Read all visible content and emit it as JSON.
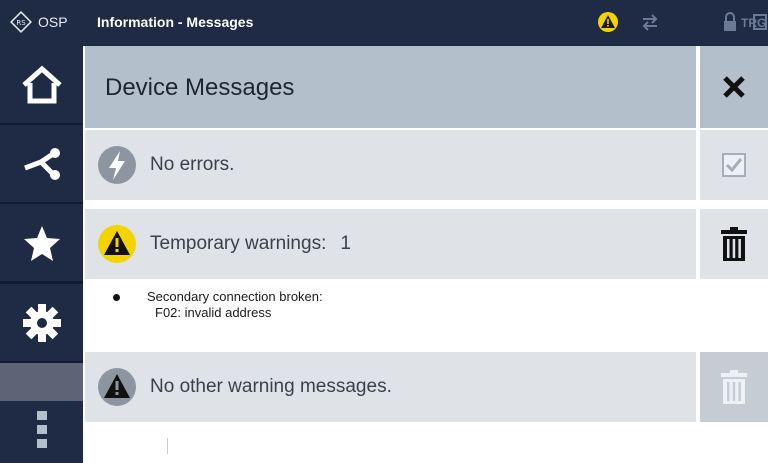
{
  "topbar": {
    "app": "OSP",
    "title": "Information - Messages",
    "trg_label": "TRG"
  },
  "nav": {
    "items": [
      "home-icon",
      "network-icon",
      "favorites-star-icon",
      "settings-gear-icon",
      "more-vertical-icon"
    ]
  },
  "panel": {
    "title": "Device Messages"
  },
  "messages": {
    "errors": {
      "text": "No errors."
    },
    "temporary": {
      "label": "Temporary warnings:",
      "count": "1"
    },
    "detail": {
      "line1": "Secondary connection broken:",
      "line2": "F02: invalid address"
    },
    "other": {
      "text": "No other warning messages."
    }
  },
  "colors": {
    "topbar": "#1f2a44",
    "nav": "#1f2a44",
    "header": "#b4bfcc",
    "row": "#dfe3e8",
    "warning_yellow": "#f4d400"
  }
}
